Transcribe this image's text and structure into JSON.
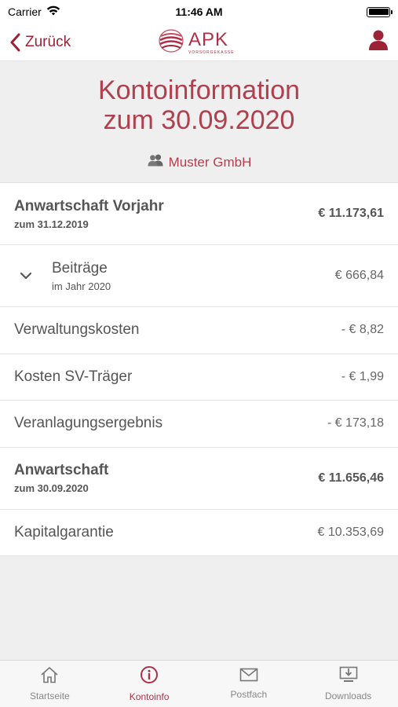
{
  "status_bar": {
    "carrier": "Carrier",
    "time": "11:46 AM"
  },
  "nav": {
    "back_label": "Zurück",
    "logo_text": "APK",
    "logo_sub": "VORSORGEKASSE"
  },
  "header": {
    "title_line1": "Kontoinformation",
    "title_line2": "zum 30.09.2020",
    "company": "Muster GmbH"
  },
  "rows": [
    {
      "label": "Anwartschaft Vorjahr",
      "sub": "zum 31.12.2019",
      "value": "€ 11.173,61"
    },
    {
      "label": "Beiträge",
      "sub": "im Jahr 2020",
      "value": "€ 666,84"
    },
    {
      "label": "Verwaltungskosten",
      "value": "- € 8,82"
    },
    {
      "label": "Kosten SV-Träger",
      "value": "- € 1,99"
    },
    {
      "label": "Veranlagungsergebnis",
      "value": "- € 173,18"
    },
    {
      "label": "Anwartschaft",
      "sub": "zum 30.09.2020",
      "value": "€ 11.656,46"
    },
    {
      "label": "Kapitalgarantie",
      "value": "€ 10.353,69"
    }
  ],
  "tabs": [
    {
      "label": "Startseite",
      "icon": "home-icon"
    },
    {
      "label": "Kontoinfo",
      "icon": "info-icon",
      "active": true
    },
    {
      "label": "Postfach",
      "icon": "mail-icon"
    },
    {
      "label": "Downloads",
      "icon": "download-icon"
    }
  ],
  "colors": {
    "accent": "#b0304a",
    "background": "#efefef"
  }
}
